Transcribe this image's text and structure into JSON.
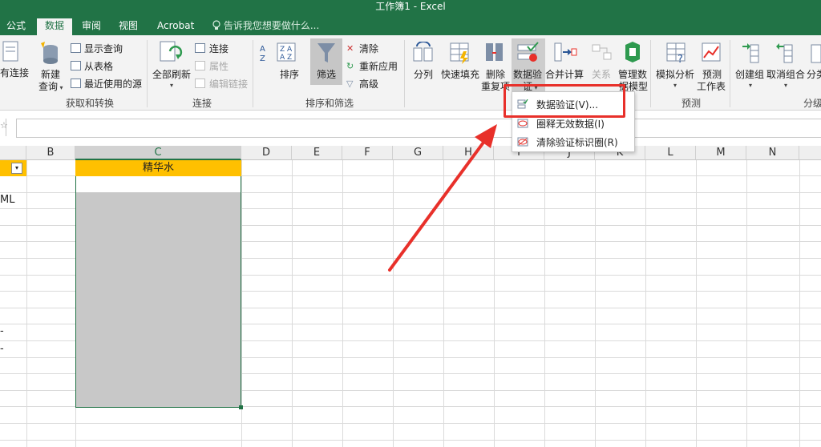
{
  "window": {
    "title": "工作簿1 - Excel"
  },
  "tabs": [
    {
      "label": "公式",
      "active": false
    },
    {
      "label": "数据",
      "active": true
    },
    {
      "label": "审阅",
      "active": false
    },
    {
      "label": "视图",
      "active": false
    },
    {
      "label": "Acrobat",
      "active": false
    }
  ],
  "tell_me": "告诉我您想要做什么...",
  "ribbon": {
    "groups": {
      "get_transform": "获取和转换",
      "connections": "连接",
      "sort_filter": "排序和筛选",
      "forecast": "预测",
      "outline": "分级"
    },
    "existing_connections": "有连接",
    "new_query": [
      "新建",
      "查询"
    ],
    "show_queries": "显示查询",
    "from_table": "从表格",
    "recent_sources": "最近使用的源",
    "refresh_all": "全部刷新",
    "connections": "连接",
    "properties": "属性",
    "edit_links": "编辑链接",
    "sort": "排序",
    "filter": "筛选",
    "clear": "清除",
    "reapply": "重新应用",
    "advanced": "高级",
    "text_to_columns": "分列",
    "flash_fill": "快速填充",
    "remove_duplicates": [
      "删除",
      "重复项"
    ],
    "data_validation": [
      "数据验",
      "证"
    ],
    "consolidate": "合并计算",
    "relationships": "关系",
    "manage_data_model": [
      "管理数",
      "据模型"
    ],
    "what_if": "模拟分析",
    "forecast_sheet": [
      "预测",
      "工作表"
    ],
    "group": "创建组",
    "ungroup": "取消组合",
    "subtotal": "分类"
  },
  "dropdown": {
    "items": [
      {
        "label": "数据验证(V)..."
      },
      {
        "label": "圈释无效数据(I)"
      },
      {
        "label": "清除验证标识圈(R)"
      }
    ]
  },
  "columns": [
    "B",
    "C",
    "D",
    "E",
    "F",
    "G",
    "H",
    "I",
    "J",
    "K",
    "L",
    "M",
    "N"
  ],
  "cells": {
    "c1_header": "精华水",
    "a2_partial": "ML",
    "a10_partial": "-",
    "a11_partial": "-"
  },
  "colors": {
    "excel_green": "#217346",
    "header_fill": "#ffc000",
    "selection_fill": "#c8c8c8",
    "annotation_red": "#e8302a"
  }
}
